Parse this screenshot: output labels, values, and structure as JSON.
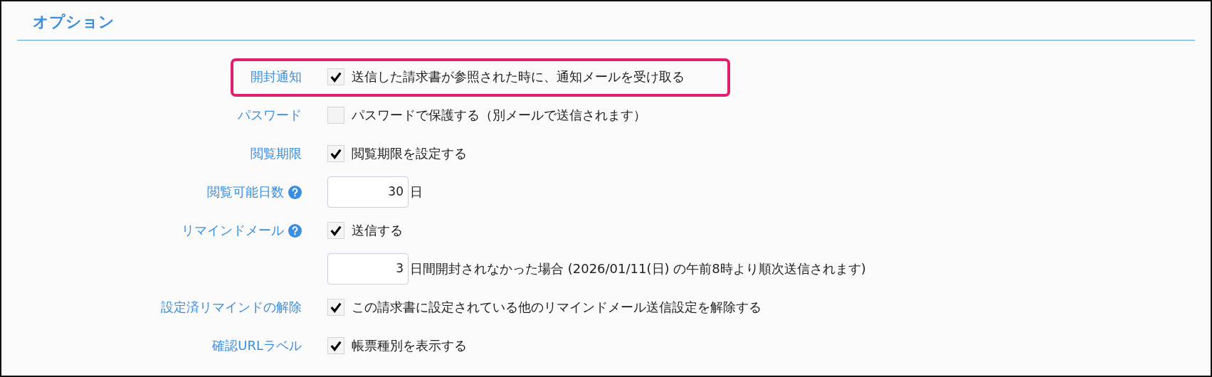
{
  "section": {
    "title": "オプション"
  },
  "rows": [
    {
      "kind": "checkbox",
      "label": "開封通知",
      "highlighted": true,
      "checked": true,
      "text": "送信した請求書が参照された時に、通知メールを受け取る"
    },
    {
      "kind": "checkbox",
      "label": "パスワード",
      "checked": false,
      "text": "パスワードで保護する（別メールで送信されます）"
    },
    {
      "kind": "checkbox",
      "label": "閲覧期限",
      "checked": true,
      "text": "閲覧期限を設定する"
    },
    {
      "kind": "input",
      "label": "閲覧可能日数",
      "help": true,
      "value": "30",
      "suffix": "日"
    },
    {
      "kind": "checkbox",
      "label": "リマインドメール",
      "help": true,
      "checked": true,
      "text": "送信する"
    },
    {
      "kind": "input",
      "value": "3",
      "suffix": "日間開封されなかった場合 (2026/01/11(日) の午前8時より順次送信されます)"
    },
    {
      "kind": "checkbox",
      "label": "設定済リマインドの解除",
      "checked": true,
      "text": "この請求書に設定されている他のリマインドメール送信設定を解除する"
    },
    {
      "kind": "checkbox",
      "label": "確認URLラベル",
      "checked": true,
      "text": "帳票種別を表示する"
    }
  ]
}
